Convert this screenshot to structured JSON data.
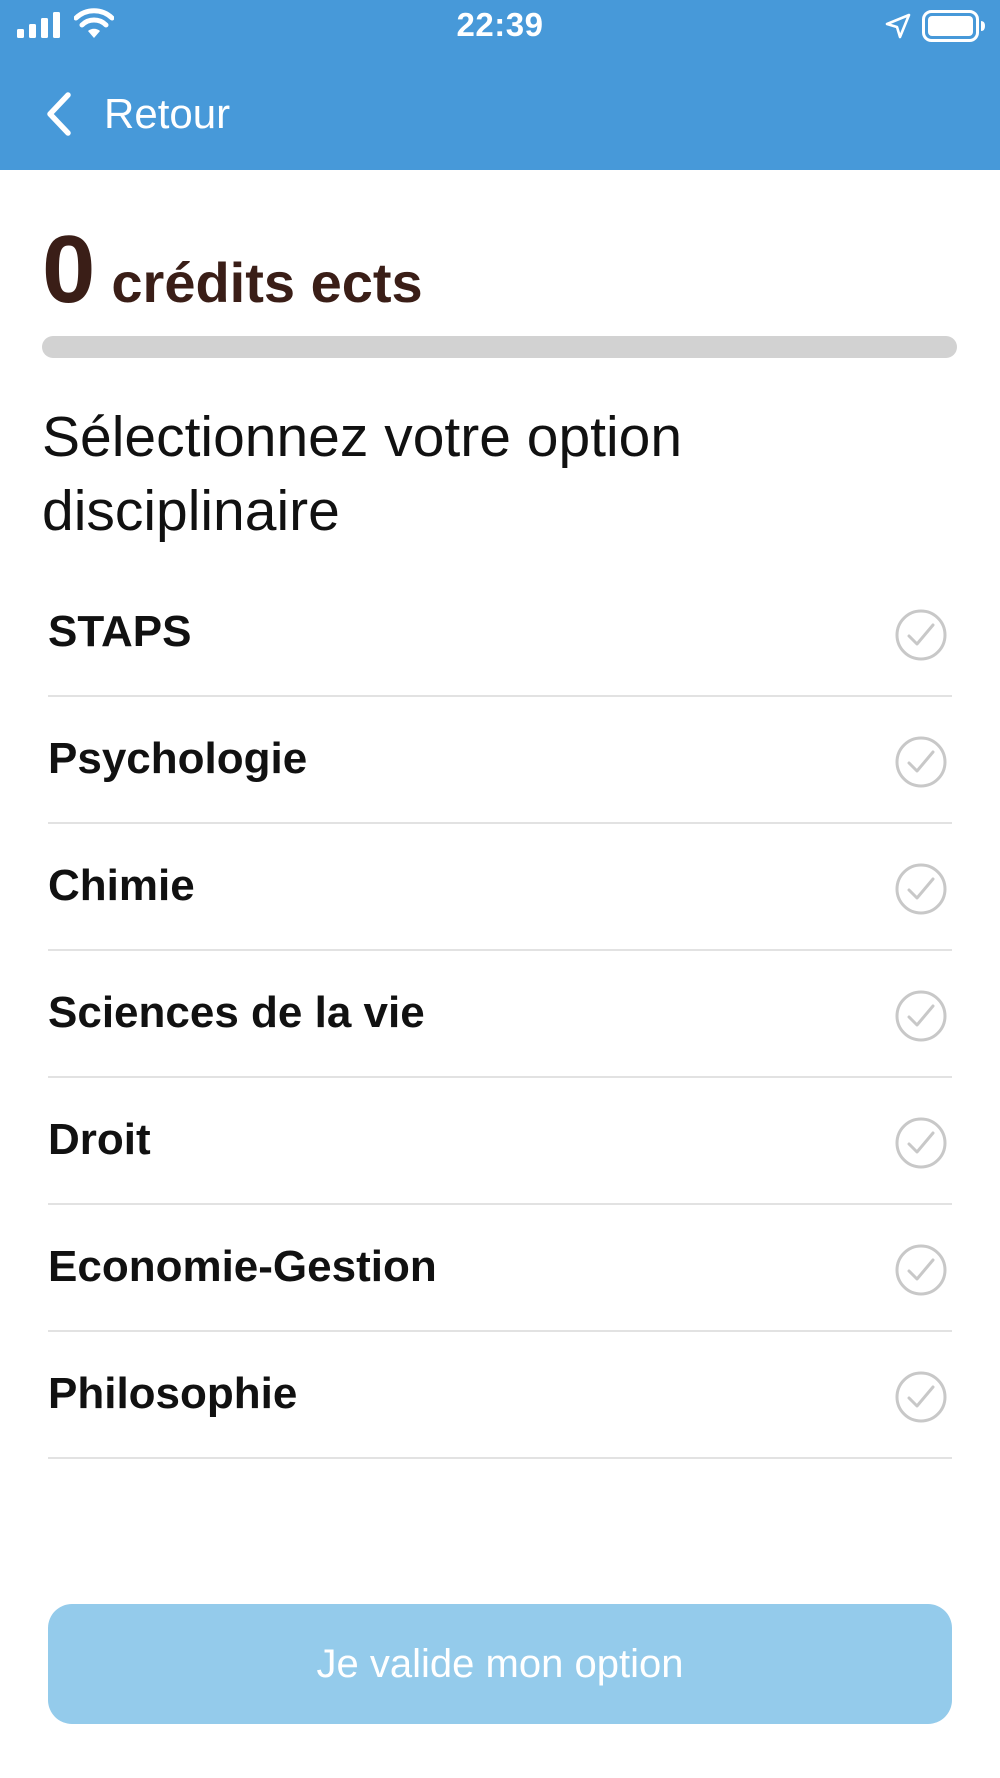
{
  "status_bar": {
    "time": "22:39"
  },
  "nav": {
    "back_label": "Retour"
  },
  "credits": {
    "value": "0",
    "unit": "crédits ects",
    "progress_fraction": 0
  },
  "title": "Sélectionnez votre option disciplinaire",
  "options": [
    {
      "label": "STAPS",
      "selected": false
    },
    {
      "label": "Psychologie",
      "selected": false
    },
    {
      "label": "Chimie",
      "selected": false
    },
    {
      "label": "Sciences de la vie",
      "selected": false
    },
    {
      "label": "Droit",
      "selected": false
    },
    {
      "label": "Economie-Gestion",
      "selected": false
    },
    {
      "label": "Philosophie",
      "selected": false
    }
  ],
  "submit": {
    "label": "Je valide mon option"
  },
  "colors": {
    "header": "#4799d9",
    "credits_text": "#3a1e17",
    "progress_track": "#d2d2d2",
    "button_disabled": "#94cbeb",
    "check_icon": "#c8c8c8"
  },
  "icons": {
    "signal": "cellular-signal-icon",
    "wifi": "wifi-icon",
    "location": "location-arrow-icon",
    "battery": "battery-icon",
    "back": "chevron-left-icon",
    "option_check": "check-circle-icon"
  }
}
